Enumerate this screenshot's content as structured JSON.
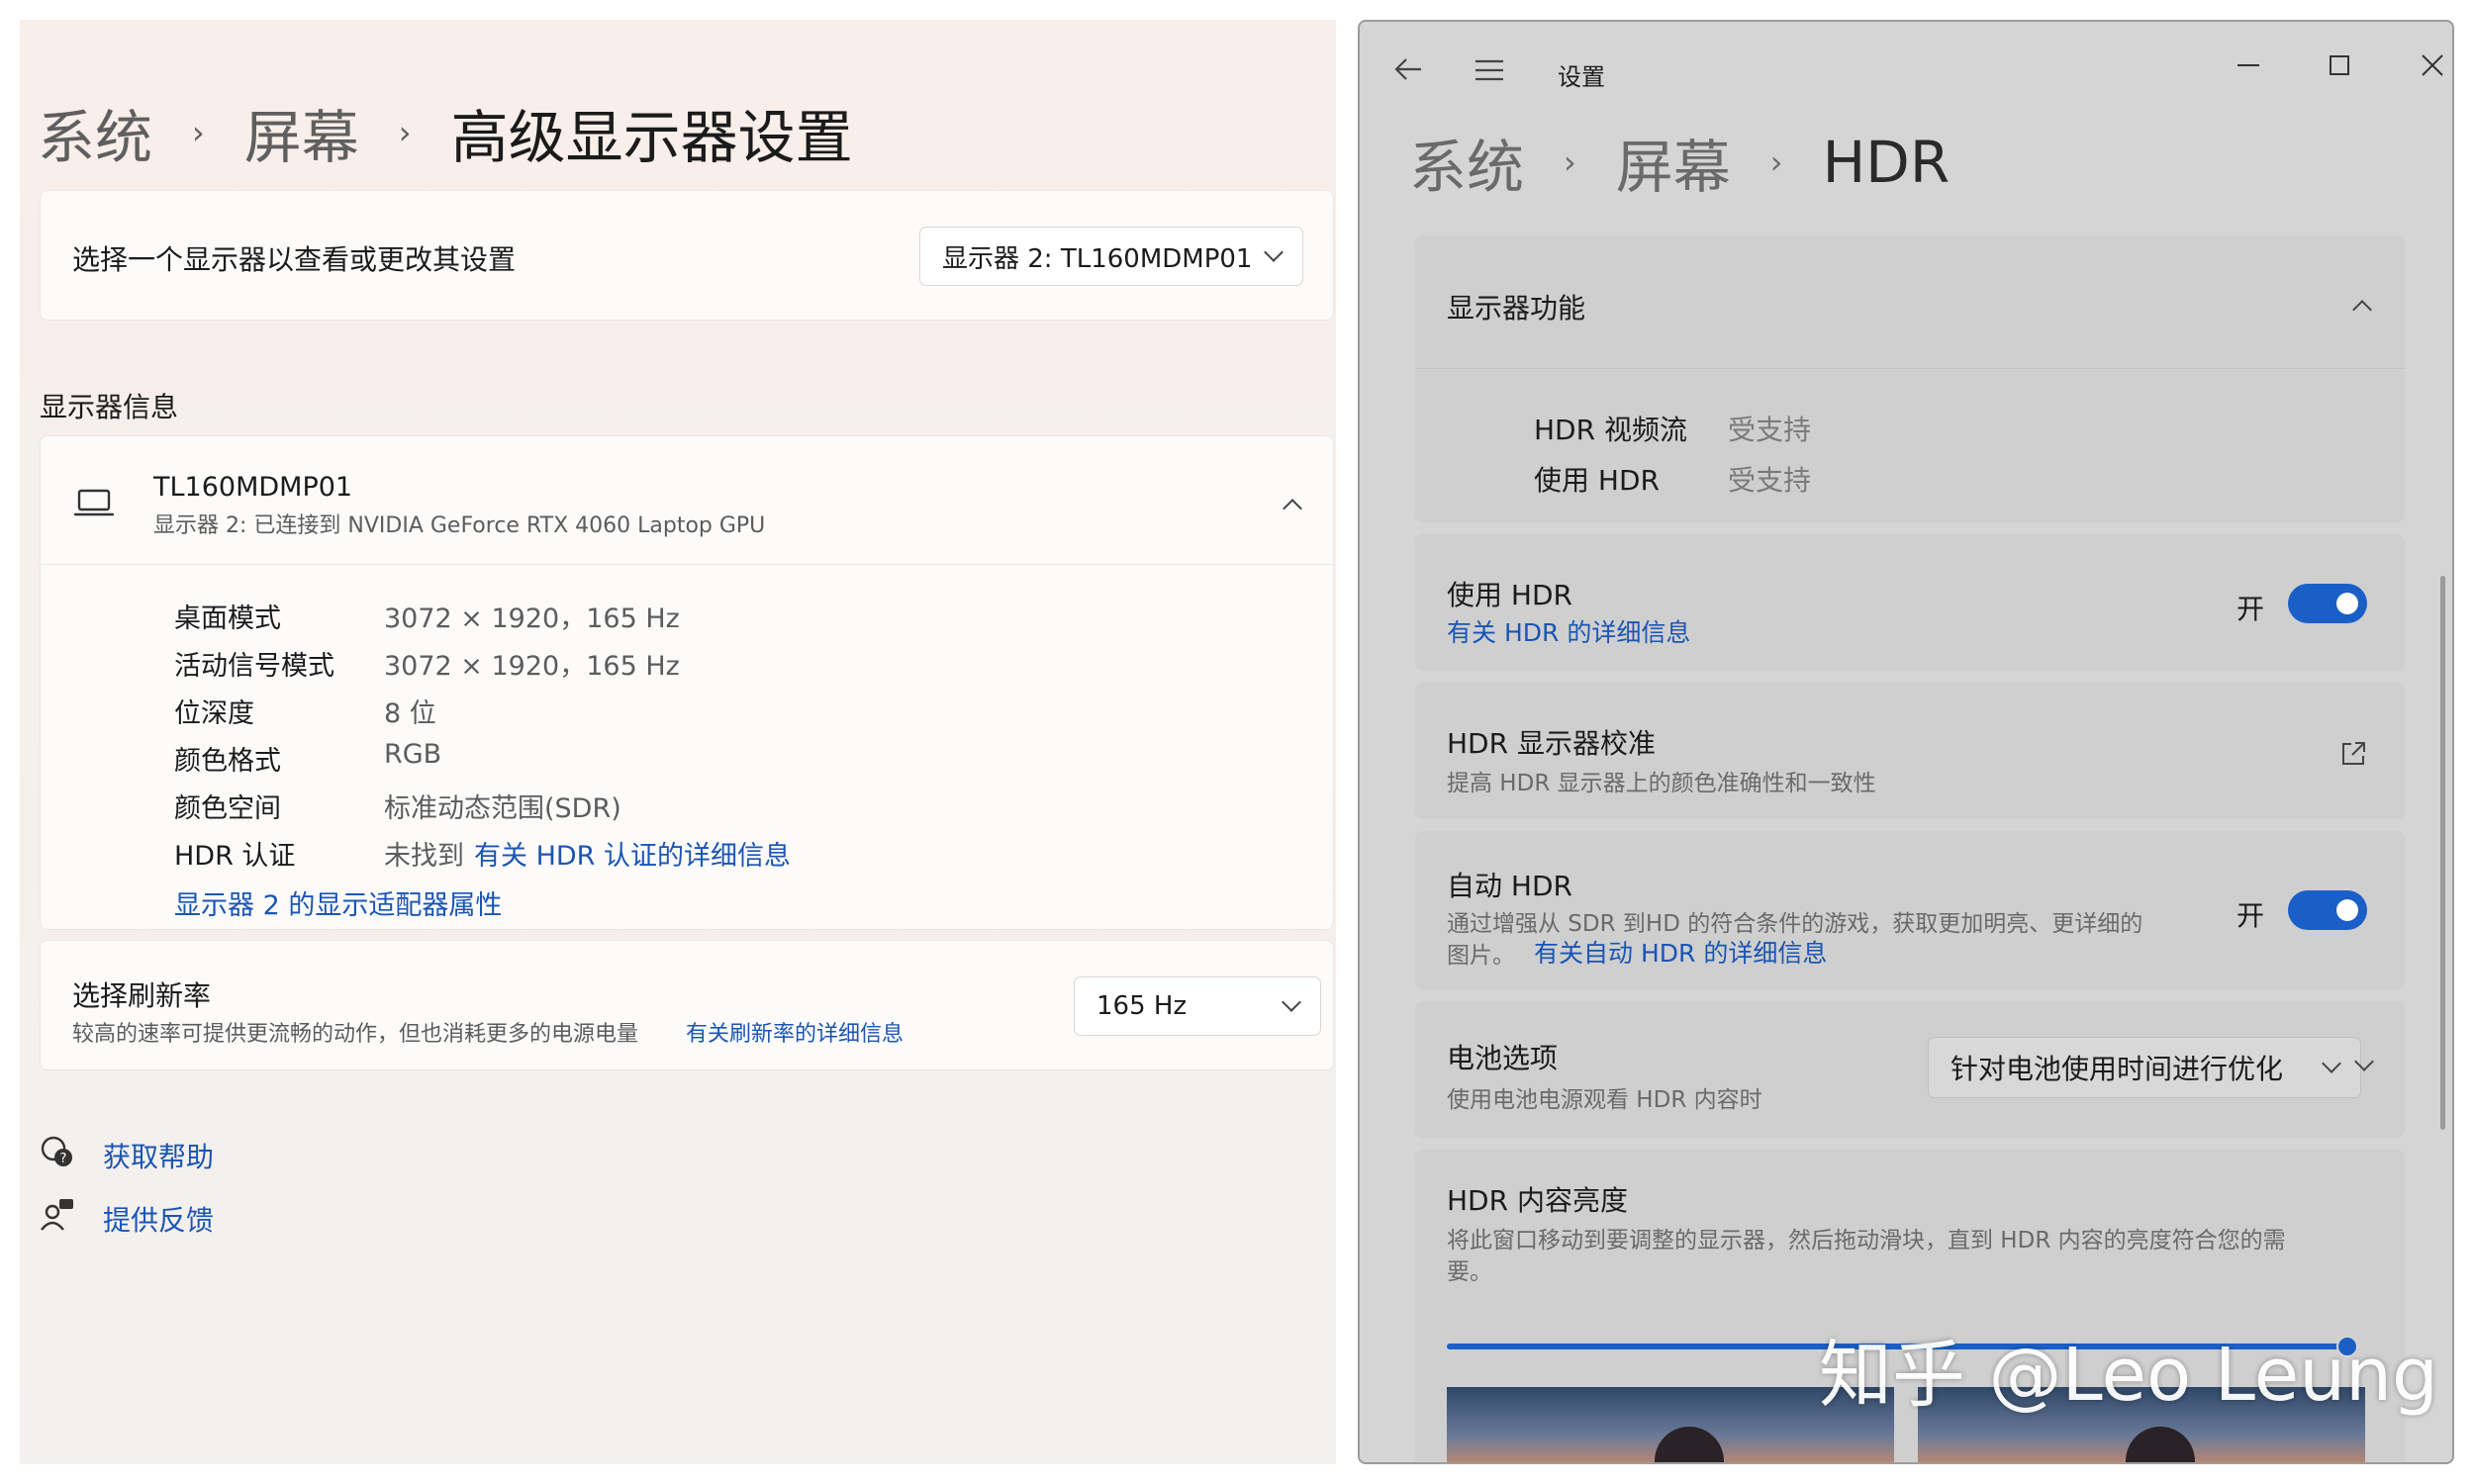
{
  "left": {
    "breadcrumb": {
      "parent1": "系统",
      "parent2": "屏幕",
      "current": "高级显示器设置",
      "sep": "›"
    },
    "select_display": {
      "label": "选择一个显示器以查看或更改其设置",
      "value": "显示器 2: TL160MDMP01"
    },
    "section_title": "显示器信息",
    "display": {
      "name": "TL160MDMP01",
      "subtitle": "显示器 2: 已连接到 NVIDIA GeForce RTX 4060 Laptop GPU",
      "rows": [
        {
          "key": "桌面模式",
          "value": "3072 × 1920，165 Hz"
        },
        {
          "key": "活动信号模式",
          "value": "3072 × 1920，165 Hz"
        },
        {
          "key": "位深度",
          "value": "8 位"
        },
        {
          "key": "颜色格式",
          "value": "RGB"
        },
        {
          "key": "颜色空间",
          "value": "标准动态范围(SDR)"
        },
        {
          "key": "HDR 认证",
          "value": "未找到",
          "link": "有关 HDR 认证的详细信息"
        }
      ],
      "adapter_link": "显示器 2 的显示适配器属性"
    },
    "refresh": {
      "title": "选择刷新率",
      "desc": "较高的速率可提供更流畅的动作，但也消耗更多的电源电量",
      "link": "有关刷新率的详细信息",
      "value": "165 Hz"
    },
    "help": {
      "get_help": "获取帮助",
      "feedback": "提供反馈"
    }
  },
  "right": {
    "window_title": "设置",
    "breadcrumb": {
      "parent1": "系统",
      "parent2": "屏幕",
      "current": "HDR",
      "sep": "›"
    },
    "capabilities": {
      "title": "显示器功能",
      "rows": [
        {
          "key": "HDR 视频流",
          "value": "受支持"
        },
        {
          "key": "使用 HDR",
          "value": "受支持"
        }
      ]
    },
    "use_hdr": {
      "title": "使用 HDR",
      "link": "有关 HDR 的详细信息",
      "state": "开"
    },
    "calibration": {
      "title": "HDR 显示器校准",
      "desc": "提高 HDR 显示器上的颜色准确性和一致性"
    },
    "auto_hdr": {
      "title": "自动 HDR",
      "desc1": "通过增强从 SDR 到HD 的符合条件的游戏，获取更加明亮、更详细的",
      "desc2": "图片。",
      "link": "有关自动 HDR 的详细信息",
      "state": "开"
    },
    "battery": {
      "title": "电池选项",
      "desc": "使用电池电源观看 HDR 内容时",
      "value": "针对电池使用时间进行优化"
    },
    "brightness": {
      "title": "HDR 内容亮度",
      "desc1": "将此窗口移动到要调整的显示器，然后拖动滑块，直到 HDR 内容的亮度符合您的需",
      "desc2": "要。",
      "slider_value_percent": 100
    },
    "watermark": "知乎 @Leo Leung"
  }
}
